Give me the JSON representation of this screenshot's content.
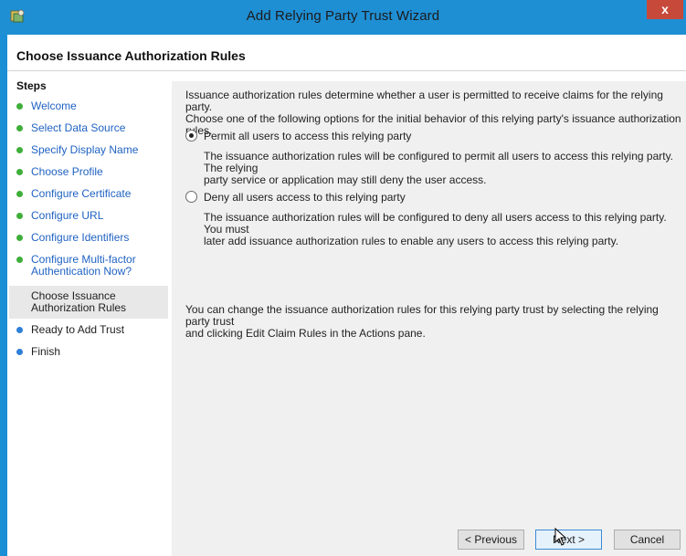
{
  "window": {
    "title": "Add Relying Party Trust Wizard",
    "close_label": "x",
    "icon": "wizard-app-icon",
    "accent_color": "#1f8fd4"
  },
  "page": {
    "title": "Choose Issuance Authorization Rules"
  },
  "steps": {
    "heading": "Steps",
    "items": [
      {
        "label": "Welcome",
        "state": "done"
      },
      {
        "label": "Select Data Source",
        "state": "done"
      },
      {
        "label": "Specify Display Name",
        "state": "done"
      },
      {
        "label": "Choose Profile",
        "state": "done"
      },
      {
        "label": "Configure Certificate",
        "state": "done"
      },
      {
        "label": "Configure URL",
        "state": "done"
      },
      {
        "label": "Configure Identifiers",
        "state": "done"
      },
      {
        "label_line1": "Configure Multi-factor",
        "label_line2": "Authentication Now?",
        "state": "done"
      },
      {
        "label_line1": "Choose Issuance",
        "label_line2": "Authorization Rules",
        "state": "current"
      },
      {
        "label": "Ready to Add Trust",
        "state": "todo"
      },
      {
        "label": "Finish",
        "state": "todo"
      }
    ]
  },
  "content": {
    "intro_line1": "Issuance authorization rules determine whether a user is permitted to receive claims for the relying party.",
    "intro_line2": "Choose one of the following options for the initial behavior of this relying party's issuance authorization rules.",
    "option_permit": {
      "label": "Permit all users to access this relying party",
      "selected": true,
      "desc_line1": "The issuance authorization rules will be configured to permit all users to access this relying party. The relying",
      "desc_line2": "party service or application may still deny the user access."
    },
    "option_deny": {
      "label": "Deny all users access to this relying party",
      "selected": false,
      "desc_line1": "The issuance authorization rules will be configured to deny all users access to this relying party. You must",
      "desc_line2": "later add issuance authorization rules to enable any users to access this relying party."
    },
    "note_line1": "You can change the issuance authorization rules for this relying party trust by selecting the relying party trust",
    "note_line2": "and clicking Edit Claim Rules in the Actions pane."
  },
  "buttons": {
    "previous": "< Previous",
    "next": "Next >",
    "cancel": "Cancel"
  }
}
